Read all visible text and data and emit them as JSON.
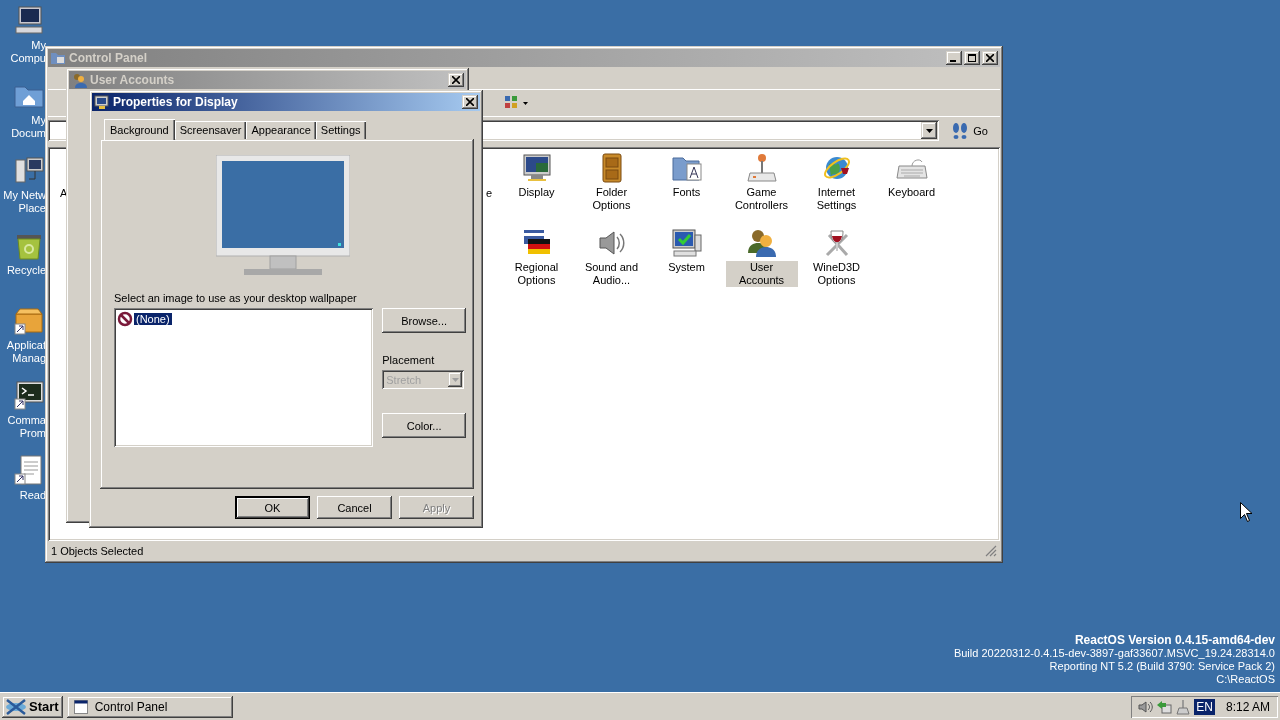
{
  "desktop": {
    "icons": [
      {
        "lines": [
          "My",
          "Compu"
        ]
      },
      {
        "lines": [
          "My",
          "Docum"
        ]
      },
      {
        "lines": [
          "My Netw",
          "Place"
        ]
      },
      {
        "lines": [
          "Recycle"
        ]
      },
      {
        "lines": [
          "Applicat",
          "Manag"
        ]
      },
      {
        "lines": [
          "Comma",
          "Prom"
        ]
      },
      {
        "lines": [
          "Read"
        ]
      }
    ]
  },
  "control_panel": {
    "title": "Control Panel",
    "active": false,
    "go_button": "Go",
    "partial_labels": [
      "A",
      "e"
    ],
    "items": [
      {
        "label": "Display",
        "selected": false
      },
      {
        "label": "Folder Options",
        "selected": false
      },
      {
        "label": "Fonts",
        "selected": false
      },
      {
        "label": "Game Controllers",
        "selected": false
      },
      {
        "label": "Internet Settings",
        "selected": false
      },
      {
        "label": "Keyboard",
        "selected": false
      },
      {
        "label": "Regional Options",
        "selected": false
      },
      {
        "label": "Sound and Audio...",
        "selected": false
      },
      {
        "label": "System",
        "selected": false
      },
      {
        "label": "User Accounts",
        "selected": true
      },
      {
        "label": "WineD3D Options",
        "selected": false
      }
    ],
    "status": "1 Objects Selected"
  },
  "user_accounts": {
    "title": "User Accounts",
    "active": false
  },
  "display_dialog": {
    "title": "Properties for Display",
    "active": true,
    "tabs": [
      {
        "label": "Background",
        "selected": true
      },
      {
        "label": "Screensaver",
        "selected": false
      },
      {
        "label": "Appearance",
        "selected": false
      },
      {
        "label": "Settings",
        "selected": false
      }
    ],
    "wallpaper_label": "Select an image to use as your desktop wallpaper",
    "wallpapers": [
      {
        "label": "(None)",
        "selected": true
      }
    ],
    "browse_button": "Browse...",
    "placement_label": "Placement",
    "placement": {
      "value": "Stretch",
      "disabled": true
    },
    "color_button": "Color...",
    "buttons": [
      {
        "label": "OK",
        "default": true,
        "disabled": false
      },
      {
        "label": "Cancel",
        "default": false,
        "disabled": false
      },
      {
        "label": "Apply",
        "default": false,
        "disabled": true
      }
    ]
  },
  "version_info": {
    "title": "ReactOS Version 0.4.15-amd64-dev",
    "lines": [
      "Build 20220312-0.4.15-dev-3897-gaf33607.MSVC_19.24.28314.0",
      "Reporting NT 5.2 (Build 3790: Service Pack 2)",
      "C:\\ReactOS"
    ]
  },
  "taskbar": {
    "start": "Start",
    "tasks": [
      {
        "label": "Control Panel",
        "selected": false
      }
    ],
    "language": "EN",
    "clock": "8:12 AM"
  }
}
